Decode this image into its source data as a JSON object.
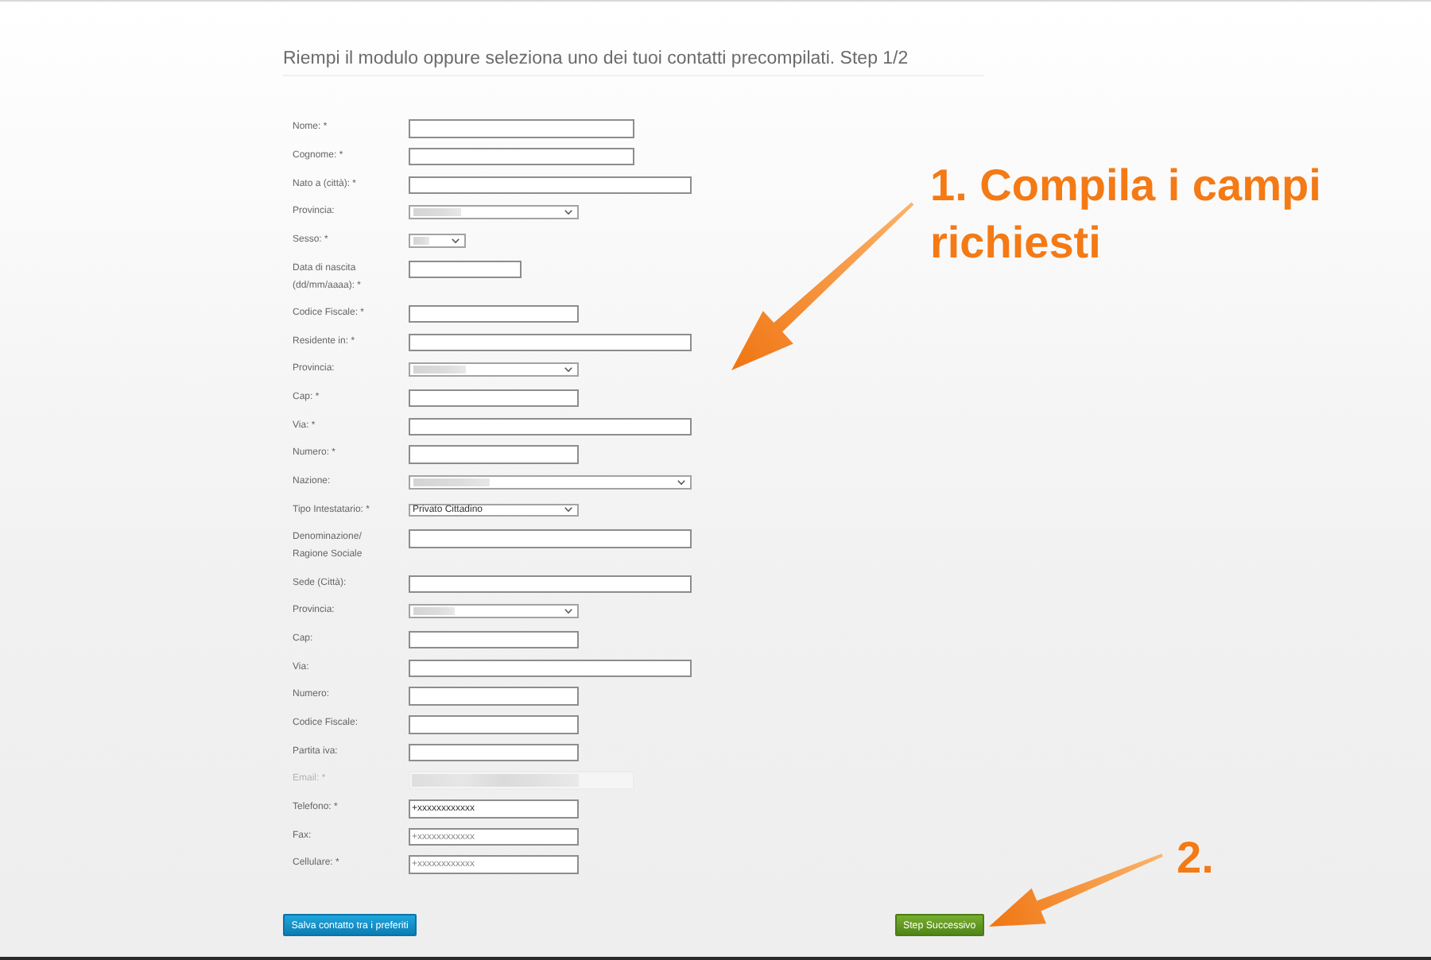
{
  "heading": "Riempi il modulo oppure seleziona uno dei tuoi contatti precompilati. Step 1/2",
  "fields": [
    {
      "label": "Nome: *",
      "kind": "text",
      "disabled": false,
      "redacted": false
    },
    {
      "label": "Cognome: *",
      "kind": "text",
      "disabled": false,
      "redacted": false
    },
    {
      "label": "Nato a (città): *",
      "kind": "text",
      "disabled": false,
      "redacted": false
    },
    {
      "label": "Provincia:",
      "kind": "select",
      "disabled": false,
      "redacted": true
    },
    {
      "label": "Sesso: *",
      "kind": "select",
      "disabled": false,
      "redacted": true
    },
    {
      "label": "Data di nascita (dd/mm/aaaa): *",
      "kind": "text",
      "disabled": false,
      "redacted": false
    },
    {
      "label": "Codice Fiscale: *",
      "kind": "text",
      "disabled": false,
      "redacted": false
    },
    {
      "label": "Residente in: *",
      "kind": "text",
      "disabled": false,
      "redacted": false
    },
    {
      "label": "Provincia:",
      "kind": "select",
      "disabled": false,
      "redacted": true
    },
    {
      "label": "Cap: *",
      "kind": "text",
      "disabled": false,
      "redacted": false
    },
    {
      "label": "Via: *",
      "kind": "text",
      "disabled": false,
      "redacted": false
    },
    {
      "label": "Numero: *",
      "kind": "text",
      "disabled": false,
      "redacted": false
    },
    {
      "label": "Nazione:",
      "kind": "select",
      "disabled": false,
      "redacted": true
    },
    {
      "label": "Tipo Intestatario: *",
      "kind": "select",
      "disabled": false,
      "redacted": false,
      "value": "Privato Cittadino"
    },
    {
      "label": "Denominazione/ Ragione Sociale",
      "kind": "text",
      "disabled": false,
      "redacted": false
    },
    {
      "label": "Sede (Città):",
      "kind": "text",
      "disabled": false,
      "redacted": false
    },
    {
      "label": "Provincia:",
      "kind": "select",
      "disabled": false,
      "redacted": true
    },
    {
      "label": "Cap:",
      "kind": "text",
      "disabled": false,
      "redacted": false
    },
    {
      "label": "Via:",
      "kind": "text",
      "disabled": false,
      "redacted": false
    },
    {
      "label": "Numero:",
      "kind": "text",
      "disabled": false,
      "redacted": false
    },
    {
      "label": "Codice Fiscale:",
      "kind": "text",
      "disabled": false,
      "redacted": false
    },
    {
      "label": "Partita iva:",
      "kind": "text",
      "disabled": false,
      "redacted": false
    },
    {
      "label": "Email: *",
      "kind": "text",
      "disabled": true,
      "redacted": true
    },
    {
      "label": "Telefono: *",
      "kind": "text",
      "disabled": false,
      "redacted": false,
      "value": "+xxxxxxxxxxxx"
    },
    {
      "label": "Fax:",
      "kind": "text",
      "disabled": false,
      "redacted": false,
      "placeholder": "+xxxxxxxxxxxx"
    },
    {
      "label": "Cellulare: *",
      "kind": "text",
      "disabled": false,
      "redacted": false,
      "placeholder": "+xxxxxxxxxxxx"
    }
  ],
  "buttons": [
    {
      "label": "Salva contatto tra i preferiti",
      "kind": "secondary"
    },
    {
      "label": "Step Successivo",
      "kind": "primary"
    }
  ],
  "annotations": [
    {
      "text": "1. Compila i campi richiesti"
    },
    {
      "text": "2."
    }
  ]
}
